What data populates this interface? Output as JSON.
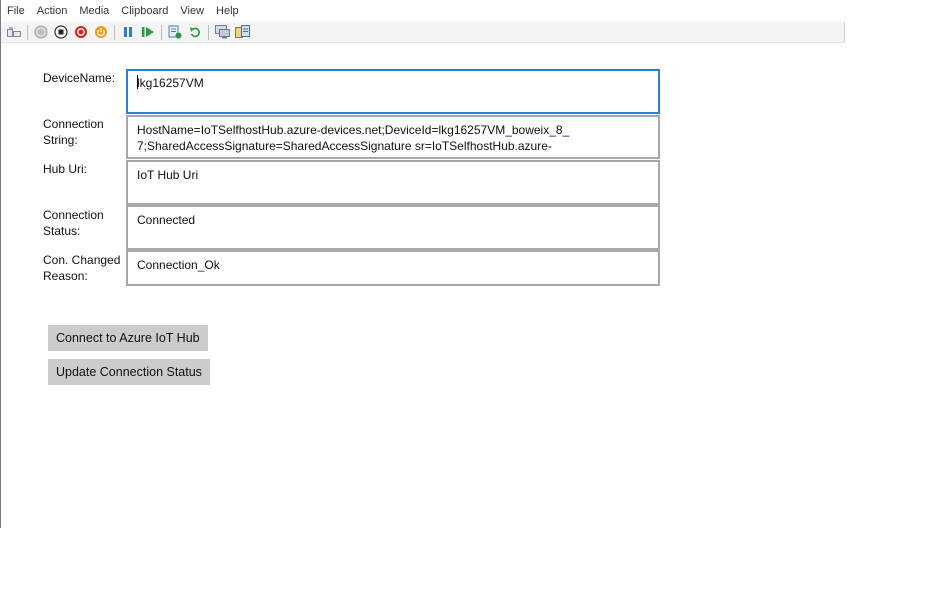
{
  "menu": [
    "File",
    "Action",
    "Media",
    "Clipboard",
    "View",
    "Help"
  ],
  "toolbar_icons": [
    "ctrl-alt-del-icon",
    "start-icon",
    "turn-off-icon",
    "shut-down-icon",
    "save-icon",
    "pause-icon",
    "resume-icon",
    "checkpoint-icon",
    "revert-icon",
    "enhanced-session-icon",
    "share-icon"
  ],
  "form": {
    "device_name": {
      "label": "DeviceName:",
      "value": "lkg16257VM"
    },
    "connection_string": {
      "label_line1": "Connection",
      "label_line2": "String:",
      "line1": "HostName=IoTSelfhostHub.azure-devices.net;DeviceId=lkg16257VM_boweix_8_",
      "line2": "7;SharedAccessSignature=SharedAccessSignature sr=IoTSelfhostHub.azure-"
    },
    "hub_uri": {
      "label": "Hub Uri:",
      "value": "IoT Hub Uri"
    },
    "connection_status": {
      "label_line1": "Connection",
      "label_line2": "Status:",
      "value": "Connected"
    },
    "con_changed_reason": {
      "label_line1": "Con. Changed",
      "label_line2": "Reason:",
      "value": "Connection_Ok"
    }
  },
  "buttons": {
    "connect": "Connect to Azure IoT Hub",
    "update": "Update Connection Status"
  },
  "colors": {
    "focus_border": "#2a7fd4",
    "button_bg": "#cccccc",
    "field_border": "#a8a8a8"
  }
}
